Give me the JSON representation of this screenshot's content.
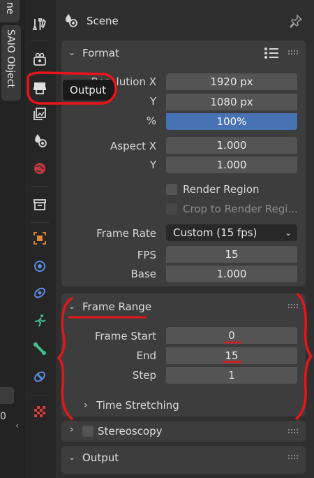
{
  "left_strip": {
    "top_tab_text": "ne",
    "saio_tab": "SAIO Object",
    "bottom_value": "0"
  },
  "tooltip": {
    "text": "Output"
  },
  "scene": {
    "title": "Scene"
  },
  "format": {
    "title": "Format",
    "resolution_x": {
      "label": "Resolution X",
      "value": "1920 px"
    },
    "resolution_y": {
      "label": "Y",
      "value": "1080 px"
    },
    "percent": {
      "label": "%",
      "value": "100%",
      "fraction": 1.0
    },
    "aspect_x": {
      "label": "Aspect X",
      "value": "1.000"
    },
    "aspect_y": {
      "label": "Y",
      "value": "1.000"
    },
    "render_region": {
      "label": "Render Region",
      "checked": false
    },
    "crop_region": {
      "label": "Crop to Render Regi...",
      "checked": false,
      "enabled": false
    },
    "frame_rate": {
      "label": "Frame Rate",
      "value": "Custom (15 fps)"
    },
    "fps": {
      "label": "FPS",
      "value": "15"
    },
    "base": {
      "label": "Base",
      "value": "1.000"
    }
  },
  "frame_range": {
    "title": "Frame Range",
    "frame_start": {
      "label": "Frame Start",
      "value": "0"
    },
    "end": {
      "label": "End",
      "value": "15"
    },
    "step": {
      "label": "Step",
      "value": "1"
    },
    "time_stretching": {
      "title": "Time Stretching"
    }
  },
  "stereoscopy": {
    "title": "Stereoscopy",
    "checked": false
  },
  "output": {
    "title": "Output"
  },
  "colors": {
    "accent_blue": "#4772b3",
    "annotation_red": "#e8151c",
    "panel_bg": "#3d3d3d",
    "field_bg": "#545454"
  }
}
